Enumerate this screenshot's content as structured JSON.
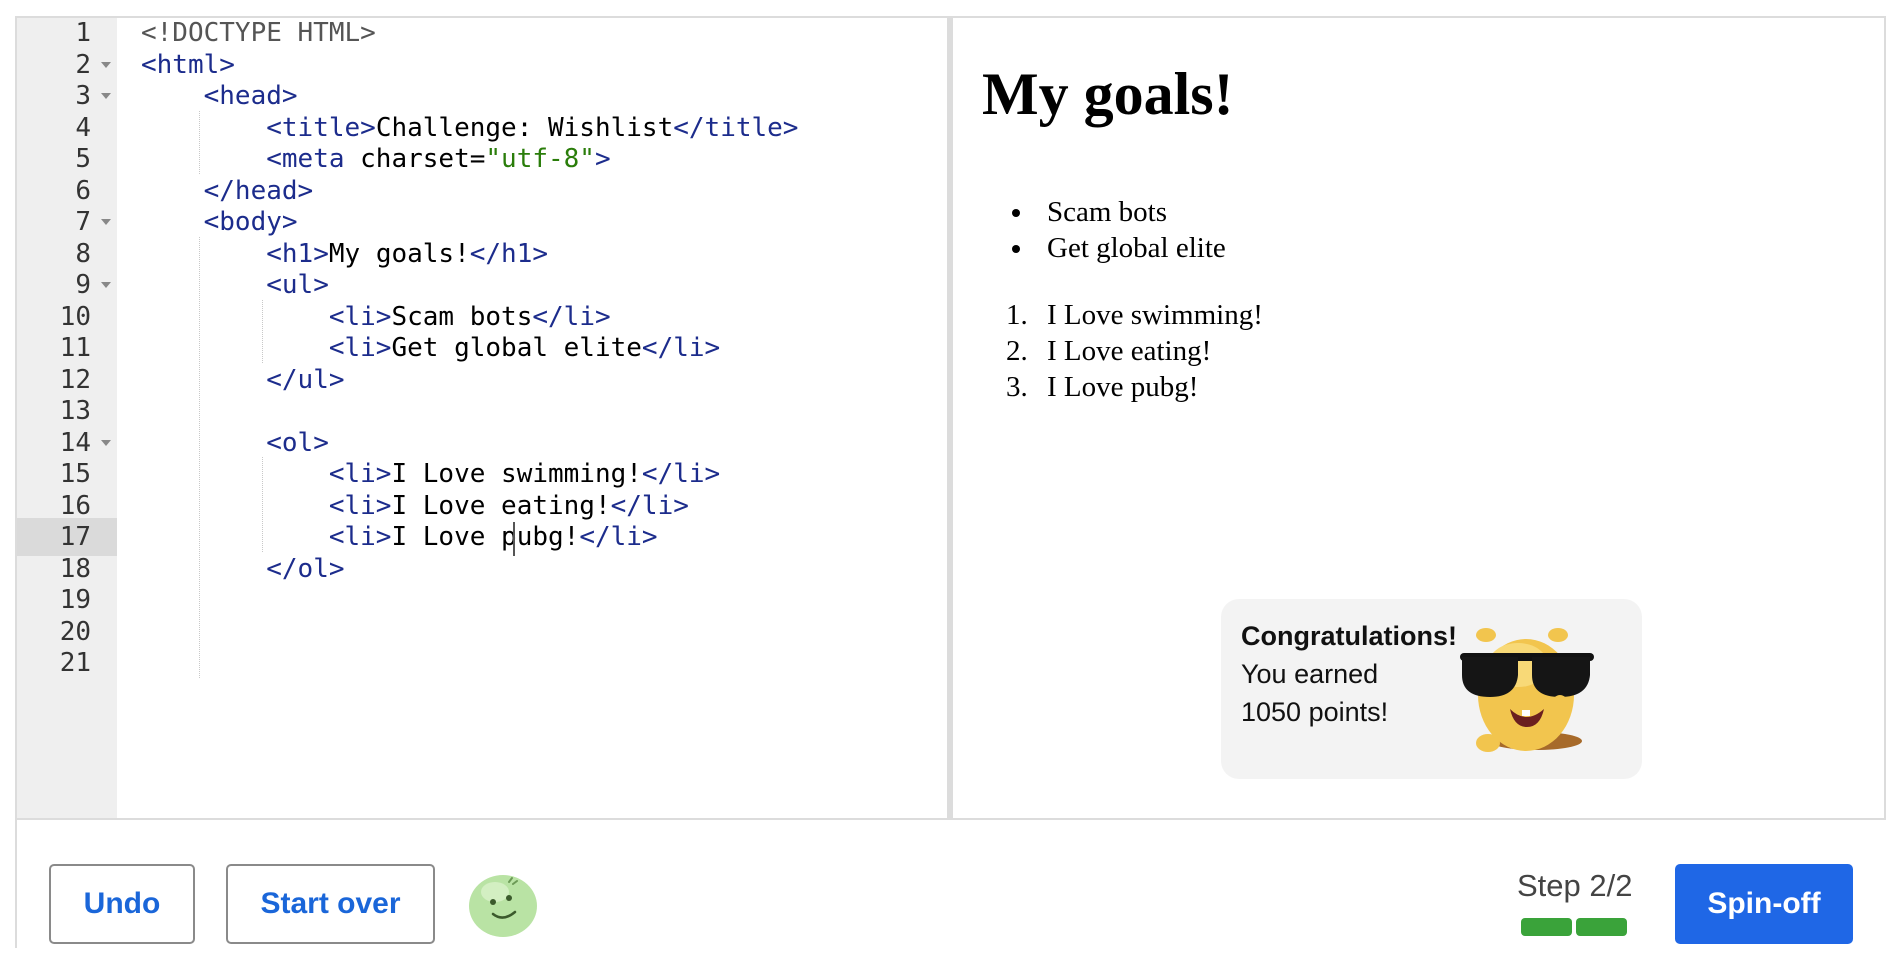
{
  "editor": {
    "line_numbers": [
      "1",
      "2",
      "3",
      "4",
      "5",
      "6",
      "7",
      "8",
      "9",
      "10",
      "11",
      "12",
      "13",
      "14",
      "15",
      "16",
      "17",
      "18",
      "19",
      "20",
      "21"
    ],
    "active_line": 17,
    "foldable_lines": [
      2,
      3,
      7,
      9,
      14
    ],
    "lines": [
      [
        {
          "t": "doctype",
          "v": "<!DOCTYPE HTML>"
        }
      ],
      [
        {
          "t": "tag",
          "v": "<html>"
        }
      ],
      [
        {
          "t": "text",
          "v": "    "
        },
        {
          "t": "tag",
          "v": "<head>"
        }
      ],
      [
        {
          "t": "text",
          "v": "        "
        },
        {
          "t": "tag",
          "v": "<title>"
        },
        {
          "t": "text",
          "v": "Challenge: Wishlist"
        },
        {
          "t": "tag",
          "v": "</title>"
        }
      ],
      [
        {
          "t": "text",
          "v": "        "
        },
        {
          "t": "tag",
          "v": "<meta "
        },
        {
          "t": "attr",
          "v": "charset="
        },
        {
          "t": "str",
          "v": "\"utf-8\""
        },
        {
          "t": "tag",
          "v": ">"
        }
      ],
      [
        {
          "t": "text",
          "v": "    "
        },
        {
          "t": "tag",
          "v": "</head>"
        }
      ],
      [
        {
          "t": "text",
          "v": "    "
        },
        {
          "t": "tag",
          "v": "<body>"
        }
      ],
      [
        {
          "t": "text",
          "v": "        "
        },
        {
          "t": "tag",
          "v": "<h1>"
        },
        {
          "t": "text",
          "v": "My goals!"
        },
        {
          "t": "tag",
          "v": "</h1>"
        }
      ],
      [
        {
          "t": "text",
          "v": "        "
        },
        {
          "t": "tag",
          "v": "<ul>"
        }
      ],
      [
        {
          "t": "text",
          "v": "            "
        },
        {
          "t": "tag",
          "v": "<li>"
        },
        {
          "t": "text",
          "v": "Scam bots"
        },
        {
          "t": "tag",
          "v": "</li>"
        }
      ],
      [
        {
          "t": "text",
          "v": "            "
        },
        {
          "t": "tag",
          "v": "<li>"
        },
        {
          "t": "text",
          "v": "Get global elite"
        },
        {
          "t": "tag",
          "v": "</li>"
        }
      ],
      [
        {
          "t": "text",
          "v": "        "
        },
        {
          "t": "tag",
          "v": "</ul>"
        }
      ],
      [],
      [
        {
          "t": "text",
          "v": "        "
        },
        {
          "t": "tag",
          "v": "<ol>"
        }
      ],
      [
        {
          "t": "text",
          "v": "            "
        },
        {
          "t": "tag",
          "v": "<li>"
        },
        {
          "t": "text",
          "v": "I Love swimming!"
        },
        {
          "t": "tag",
          "v": "</li>"
        }
      ],
      [
        {
          "t": "text",
          "v": "            "
        },
        {
          "t": "tag",
          "v": "<li>"
        },
        {
          "t": "text",
          "v": "I Love eating!"
        },
        {
          "t": "tag",
          "v": "</li>"
        }
      ],
      [
        {
          "t": "text",
          "v": "            "
        },
        {
          "t": "tag",
          "v": "<li>"
        },
        {
          "t": "text",
          "v": "I Love pubg!"
        },
        {
          "t": "tag",
          "v": "</li>"
        }
      ],
      [
        {
          "t": "text",
          "v": "        "
        },
        {
          "t": "tag",
          "v": "</ol>"
        }
      ],
      [],
      [],
      []
    ]
  },
  "preview": {
    "heading": "My goals!",
    "unordered_items": [
      "Scam bots",
      "Get global elite"
    ],
    "ordered_items": [
      "I Love swimming!",
      "I Love eating!",
      "I Love pubg!"
    ]
  },
  "congrats": {
    "title": "Congratulations!",
    "line1": "You earned",
    "line2": "1050 points!"
  },
  "toolbar": {
    "undo_label": "Undo",
    "start_over_label": "Start over",
    "step_label": "Step 2/2",
    "step_total": 2,
    "step_completed": 2,
    "spinoff_label": "Spin-off"
  },
  "colors": {
    "accent_blue": "#1f67e6",
    "progress_green": "#3aa33a",
    "tag_color": "#1c2c8c",
    "string_color": "#2a7d0a"
  },
  "icons": {
    "mascot": "sunglasses-monster-icon",
    "avatar": "green-blob-avatar-icon"
  }
}
